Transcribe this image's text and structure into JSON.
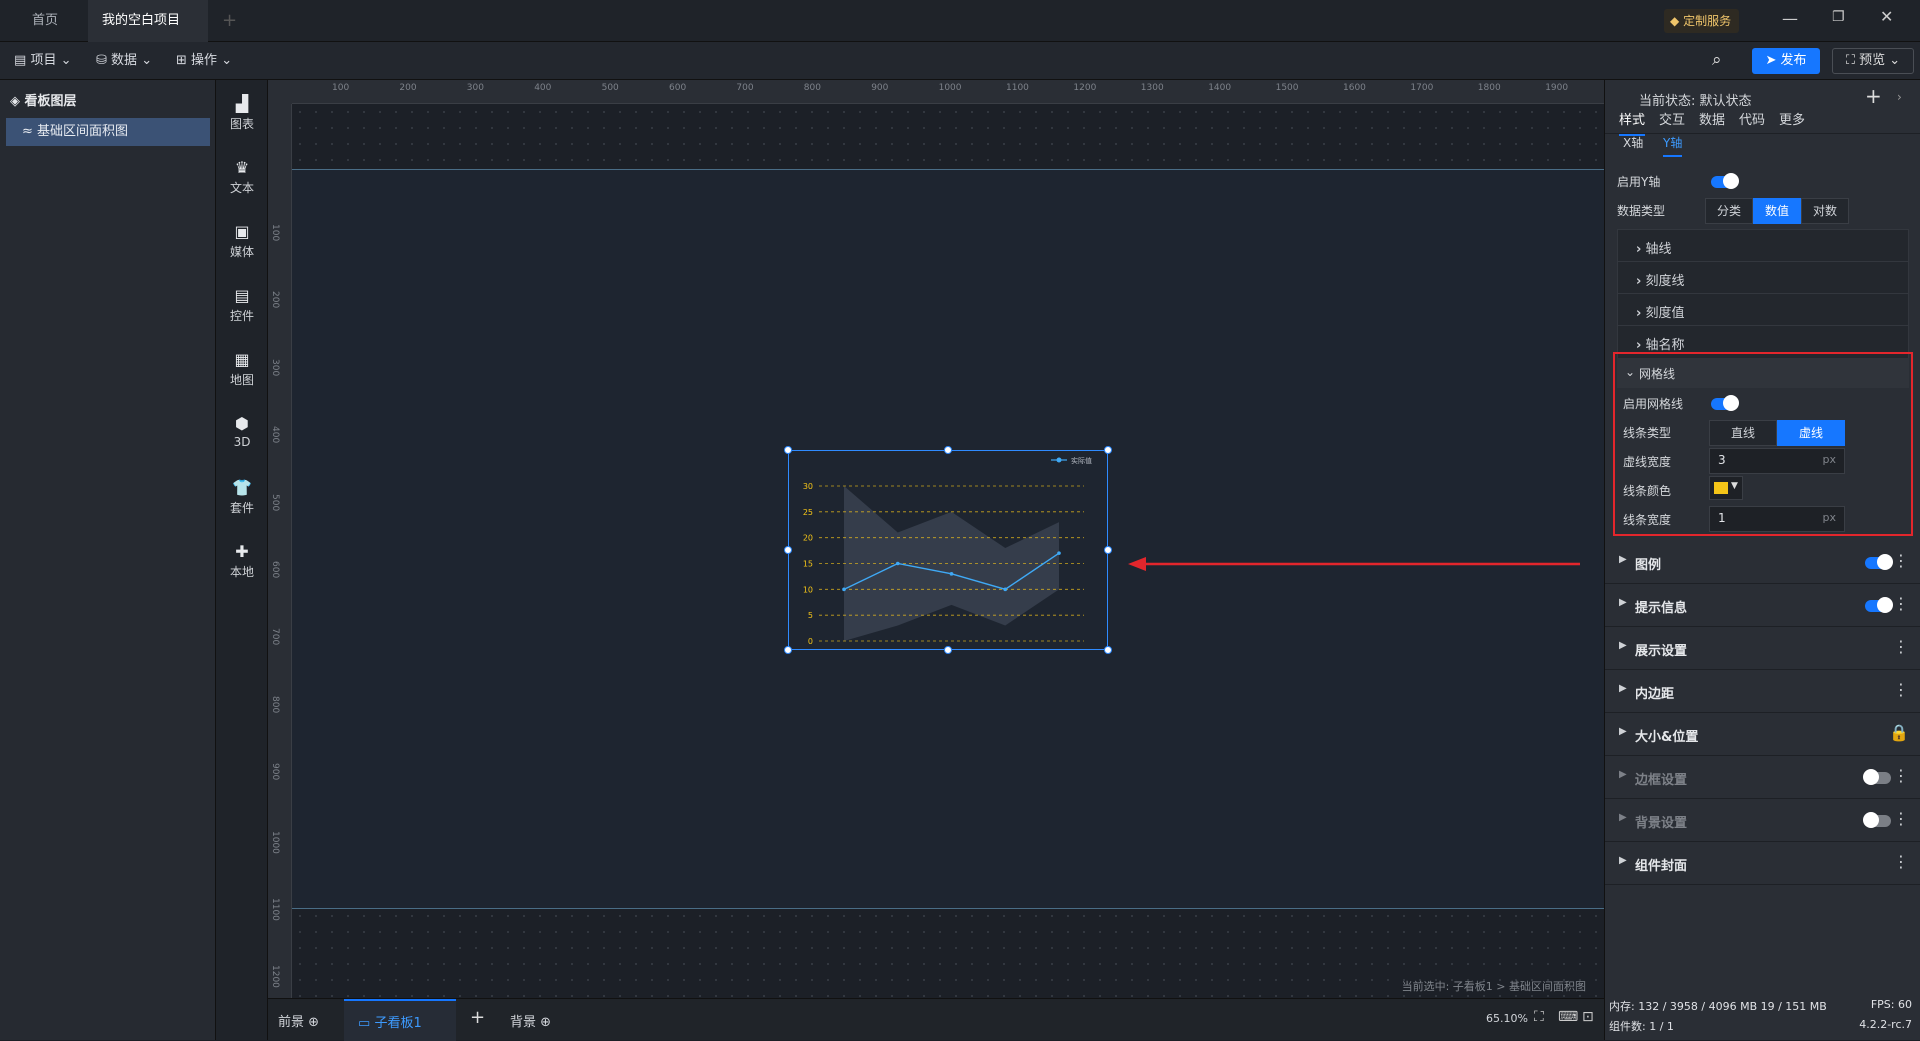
{
  "titlebar": {
    "tab_home": "首页",
    "tab_project": "我的空白项目",
    "custom_service": "定制服务"
  },
  "menubar": {
    "project": "项目",
    "data": "数据",
    "operate": "操作",
    "publish": "发布",
    "preview": "预览"
  },
  "layers": {
    "title": "看板图层",
    "item": "基础区间面积图"
  },
  "tools": [
    {
      "icon": "chart-icon",
      "label": "图表"
    },
    {
      "icon": "text-icon",
      "label": "文本"
    },
    {
      "icon": "media-icon",
      "label": "媒体"
    },
    {
      "icon": "control-icon",
      "label": "控件"
    },
    {
      "icon": "map-icon",
      "label": "地图"
    },
    {
      "icon": "3d-icon",
      "label": "3D"
    },
    {
      "icon": "suite-icon",
      "label": "套件"
    },
    {
      "icon": "local-icon",
      "label": "本地"
    }
  ],
  "ruler": {
    "h": [
      "100",
      "200",
      "300",
      "400",
      "500",
      "600",
      "700",
      "800",
      "900",
      "1000",
      "1100",
      "1200",
      "1300",
      "1400",
      "1500",
      "1600",
      "1700",
      "1800",
      "1900"
    ],
    "v": [
      "100",
      "200",
      "300",
      "400",
      "500",
      "600",
      "700",
      "800",
      "900",
      "1000",
      "1100",
      "1200"
    ]
  },
  "chart_data": {
    "type": "area",
    "legend": "实际值",
    "ylim": [
      0,
      30
    ],
    "yticks": [
      "30",
      "25",
      "20",
      "15",
      "10",
      "5",
      "0"
    ],
    "line": [
      10,
      15,
      13,
      10,
      17
    ],
    "band_high": [
      30,
      21,
      25,
      18,
      23
    ],
    "band_low": [
      0,
      3,
      7,
      3,
      10
    ],
    "grid_color": "#f5c518",
    "line_color": "#3fa9f5"
  },
  "canvas": {
    "selection": "当前选中: 子看板1 > 基础区间面积图"
  },
  "status": {
    "foreground": "前景",
    "subboard": "子看板1",
    "background": "背景",
    "zoom": "65.10%",
    "memory": "内存: 132 / 3958 / 4096 MB  19 / 151 MB",
    "components": "组件数: 1 / 1",
    "fps": "FPS: 60",
    "version": "4.2.2-rc.7"
  },
  "right": {
    "state": "当前状态: 默认状态",
    "tabs": [
      "样式",
      "交互",
      "数据",
      "代码",
      "更多"
    ],
    "subtabs": [
      "X轴",
      "Y轴"
    ],
    "enable_y": "启用Y轴",
    "data_type": "数据类型",
    "data_type_opts": [
      "分类",
      "数值",
      "对数"
    ],
    "collapsed": [
      "轴线",
      "刻度线",
      "刻度值",
      "轴名称"
    ],
    "grid": {
      "title": "网格线",
      "enable": "启用网格线",
      "line_type": "线条类型",
      "line_type_opts": [
        "直线",
        "虚线"
      ],
      "dash_width": "虚线宽度",
      "dash_value": "3",
      "color": "线条颜色",
      "line_width": "线条宽度",
      "line_value": "1",
      "unit": "px",
      "color_value": "#f5c518"
    },
    "sections": [
      "图例",
      "提示信息",
      "展示设置",
      "内边距",
      "大小&位置",
      "边框设置",
      "背景设置",
      "组件封面"
    ]
  }
}
